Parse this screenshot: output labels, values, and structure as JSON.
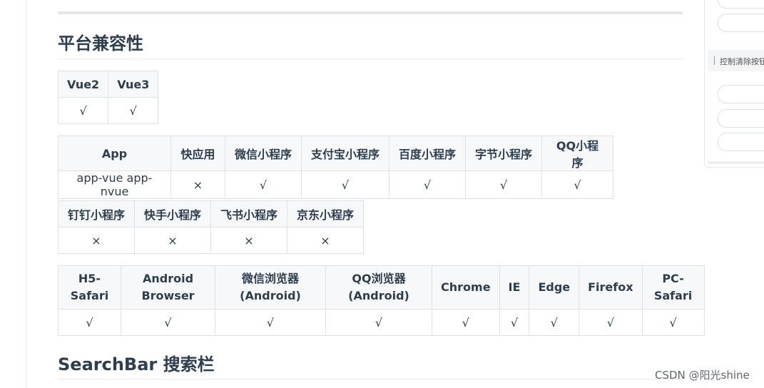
{
  "section_title": "平台兼容性",
  "vue_table": {
    "headers": [
      "Vue2",
      "Vue3"
    ],
    "row": [
      "√",
      "√"
    ]
  },
  "app_table": {
    "headers": [
      "App",
      "快应用",
      "微信小程序",
      "支付宝小程序",
      "百度小程序",
      "字节小程序",
      "QQ小程序"
    ],
    "row": [
      "app-vue app-nvue",
      "×",
      "√",
      "√",
      "√",
      "√",
      "√"
    ]
  },
  "mp_table": {
    "headers": [
      "钉钉小程序",
      "快手小程序",
      "飞书小程序",
      "京东小程序"
    ],
    "row": [
      "×",
      "×",
      "×",
      "×"
    ]
  },
  "browser_table": {
    "headers": [
      [
        "H5-",
        "Safari"
      ],
      [
        "Android",
        "Browser"
      ],
      [
        "微信浏览器",
        "(Android)"
      ],
      [
        "QQ浏览器",
        "(Android)"
      ],
      [
        "Chrome"
      ],
      [
        "IE"
      ],
      [
        "Edge"
      ],
      [
        "Firefox"
      ],
      [
        "PC-",
        "Safari"
      ]
    ],
    "row": [
      "√",
      "√",
      "√",
      "√",
      "√",
      "√",
      "√",
      "√",
      "√"
    ]
  },
  "next_section_title": "SearchBar 搜索栏",
  "side_panel": {
    "label": "控制清除按钮"
  },
  "watermark": "CSDN @阳光shine"
}
